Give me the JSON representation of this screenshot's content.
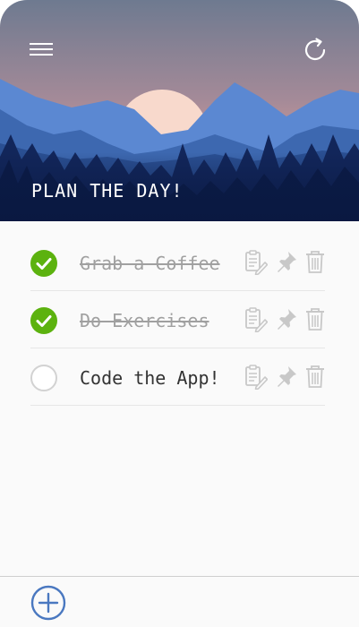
{
  "header": {
    "title": "PLAN THE DAY!",
    "menu_icon": "hamburger-menu-icon",
    "refresh_icon": "refresh-icon",
    "colors": {
      "sky_top": "#6f7b92",
      "sky_bottom": "#d69a9a",
      "sun": "#f8d8cc",
      "mountain_far": "#5a87d0",
      "mountain_mid": "#2f5aa0",
      "forest": "#0f2150"
    }
  },
  "tasks": [
    {
      "label": "Grab a Coffee",
      "done": true
    },
    {
      "label": "Do Exercises",
      "done": true
    },
    {
      "label": "Code the App!",
      "done": false
    }
  ],
  "task_action_icons": [
    "edit-note-icon",
    "pin-icon",
    "trash-icon"
  ],
  "footer": {
    "add_icon": "add-circle-icon"
  },
  "colors": {
    "done_check": "#5cb20f",
    "text": "#333333",
    "done_text": "#a0a0a0",
    "action_icon": "#c8c8c8",
    "accent": "#4a78c0"
  }
}
